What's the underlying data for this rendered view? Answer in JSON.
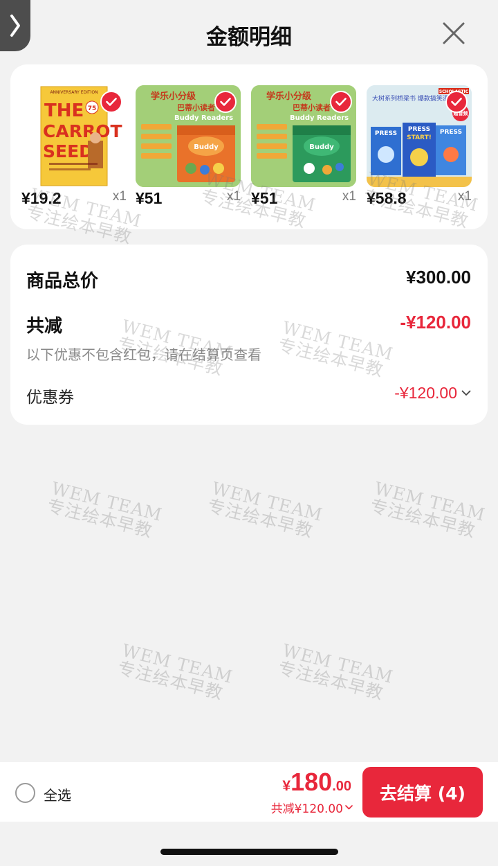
{
  "header": {
    "title": "金额明细",
    "back_icon": "chevron-right-icon",
    "close_icon": "close-icon"
  },
  "products": [
    {
      "price": "¥19.2",
      "qty": "x1",
      "cover_title": "THE CARROT SEED",
      "cover_badge": "75",
      "cover_top": "ANNIVERSARY EDITION"
    },
    {
      "price": "¥51",
      "qty": "x1",
      "cover_title": "Buddy Readers",
      "cover_top": "学乐小分级",
      "cover_sub": "巴蒂小读者"
    },
    {
      "price": "¥51",
      "qty": "x1",
      "cover_title": "Buddy Readers",
      "cover_top": "学乐小分级",
      "cover_sub": "巴蒂小读者"
    },
    {
      "price": "¥58.8",
      "qty": "x1",
      "cover_title": "PRESS START!",
      "cover_top": "大树系列桥梁书 爆款搞笑漫画",
      "cover_badge": "赠音频",
      "cover_brand": "SCHOLASTIC"
    }
  ],
  "summary": {
    "total_label": "商品总价",
    "total_value": "¥300.00",
    "discount_label": "共减",
    "discount_value": "-¥120.00",
    "note": "以下优惠不包含红包，请在结算页查看",
    "coupon_label": "优惠券",
    "coupon_value": "-¥120.00"
  },
  "watermark": {
    "line1": "WEM TEAM",
    "line2": "专注绘本早教"
  },
  "bottom_bar": {
    "select_all": "全选",
    "currency": "¥",
    "amount_int": "180",
    "amount_dec": ".00",
    "discount_text": "共减¥120.00",
    "checkout_label": "去结算 (4)"
  },
  "colors": {
    "accent": "#e8273b",
    "background": "#f2f2f2",
    "card": "#ffffff"
  }
}
